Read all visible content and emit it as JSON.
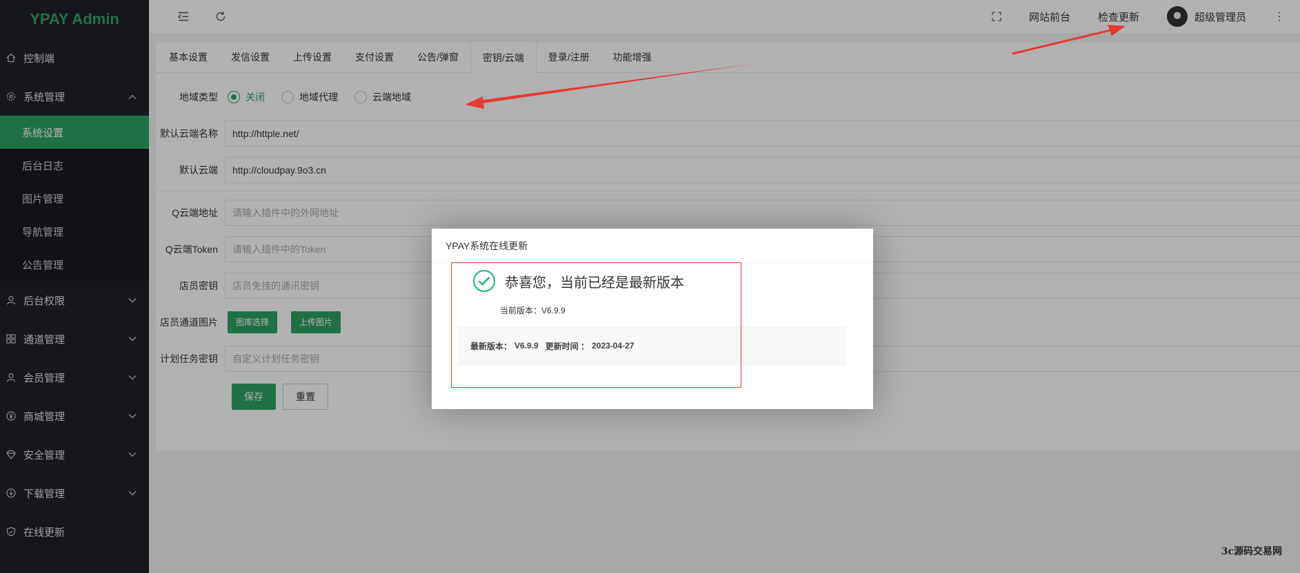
{
  "app": {
    "logo": "YPAY Admin"
  },
  "colors": {
    "accent": "#2ea164",
    "sidebar_bg": "#20222a",
    "annotation": "#e53935"
  },
  "sidebar": {
    "items": [
      {
        "label": "控制端",
        "icon": "home-icon"
      },
      {
        "label": "系统管理",
        "icon": "gear-icon",
        "expanded": true,
        "children": [
          "系统设置",
          "后台日志",
          "图片管理",
          "导航管理",
          "公告管理"
        ],
        "active_child": "系统设置"
      },
      {
        "label": "后台权限",
        "icon": "user-icon"
      },
      {
        "label": "通道管理",
        "icon": "apps-icon"
      },
      {
        "label": "会员管理",
        "icon": "user-icon"
      },
      {
        "label": "商城管理",
        "icon": "yen-icon"
      },
      {
        "label": "安全管理",
        "icon": "diamond-icon"
      },
      {
        "label": "下载管理",
        "icon": "download-icon"
      },
      {
        "label": "在线更新",
        "icon": "shield-icon"
      }
    ]
  },
  "header": {
    "front_link": "网站前台",
    "check_update": "检查更新",
    "user_name": "超级管理员"
  },
  "tabs": [
    "基本设置",
    "发信设置",
    "上传设置",
    "支付设置",
    "公告/弹窗",
    "密钥/云端",
    "登录/注册",
    "功能增强"
  ],
  "active_tab": "密钥/云端",
  "form": {
    "region_type_label": "地域类型",
    "region_options": [
      "关闭",
      "地域代理",
      "云端地域"
    ],
    "region_selected": "关闭",
    "default_cloud_name_label": "默认云端名称",
    "default_cloud_name_value": "http://httple.net/",
    "default_cloud_label": "默认云端",
    "default_cloud_value": "http://cloudpay.9o3.cn",
    "q_cloud_addr_label": "Q云端地址",
    "q_cloud_addr_placeholder": "请输入插件中的外网地址",
    "q_cloud_token_label": "Q云端Token",
    "q_cloud_token_placeholder": "请输入插件中的Token",
    "store_key_label": "店员密钥",
    "store_key_placeholder": "店员免挂的通讯密钥",
    "store_channel_img_label": "店员通道图片",
    "gallery_button": "图库选择",
    "upload_button": "上传图片",
    "cron_key_label": "计划任务密钥",
    "cron_key_placeholder": "自定义计划任务密钥",
    "save_button": "保存",
    "reset_button": "重置"
  },
  "modal": {
    "title": "YPAY系统在线更新",
    "message": "恭喜您，当前已经是最新版本",
    "current_version": "当前版本：V6.9.9",
    "latest_label": "最新版本：",
    "latest_version": "V6.9.9",
    "update_time_label": "更新时间 ：",
    "update_time": "2023-04-27"
  },
  "watermark": "3c源码交易网"
}
